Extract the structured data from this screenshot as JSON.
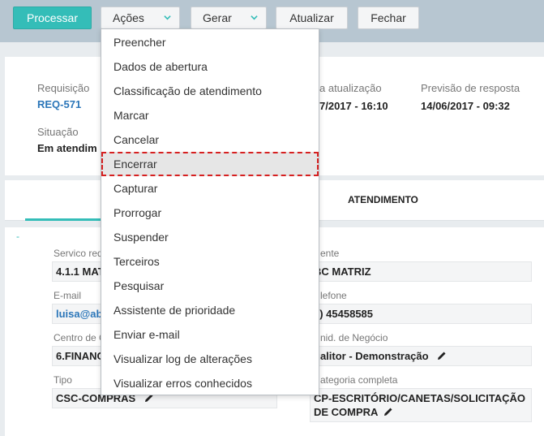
{
  "toolbar": {
    "processar": "Processar",
    "acoes": "Ações",
    "gerar": "Gerar",
    "atualizar": "Atualizar",
    "fechar": "Fechar"
  },
  "header": {
    "requisicao_label": "Requisição",
    "requisicao_value": "REQ-571",
    "situacao_label": "Situação",
    "situacao_value": "Em atendim",
    "ultima_label": "a atualização",
    "ultima_value": "7/2017 - 16:10",
    "previsao_label": "Previsão de resposta",
    "previsao_value": "14/06/2017 - 09:32"
  },
  "tabs": {
    "atendimento": "ATENDIMENTO"
  },
  "details": {
    "dash": "-",
    "servico_label": "Servico req",
    "servico_value": "4.1.1 MAT",
    "email_label": "E-mail",
    "email_value": "luisa@ab",
    "centro_label": "Centro de C",
    "centro_value": "6.FINANC",
    "tipo_label": "Tipo",
    "tipo_value": "CSC-COMPRAS",
    "cliente_label": "ente",
    "cliente_value": "BC MATRIZ",
    "telefone_label": "lefone",
    "telefone_value": "1) 45458585",
    "unid_label": "nid. de Negócio",
    "unid_value": "ualitor - Demonstração",
    "categoria_label": "ategoria completa",
    "categoria_line1": "CP-ESCRITÓRIO/CANETAS/SOLICITAÇÃO",
    "categoria_line2": "DE COMPRA"
  },
  "menu": {
    "items": [
      "Preencher",
      "Dados de abertura",
      "Classificação de atendimento",
      "Marcar",
      "Cancelar",
      "Encerrar",
      "Capturar",
      "Prorrogar",
      "Suspender",
      "Terceiros",
      "Pesquisar",
      "Assistente de prioridade",
      "Enviar e-mail",
      "Visualizar log de alterações",
      "Visualizar erros conhecidos"
    ],
    "highlighted": "Encerrar"
  },
  "colors": {
    "accent": "#34bdb8",
    "link": "#2b76b9",
    "highlight_outline": "#d62020"
  }
}
